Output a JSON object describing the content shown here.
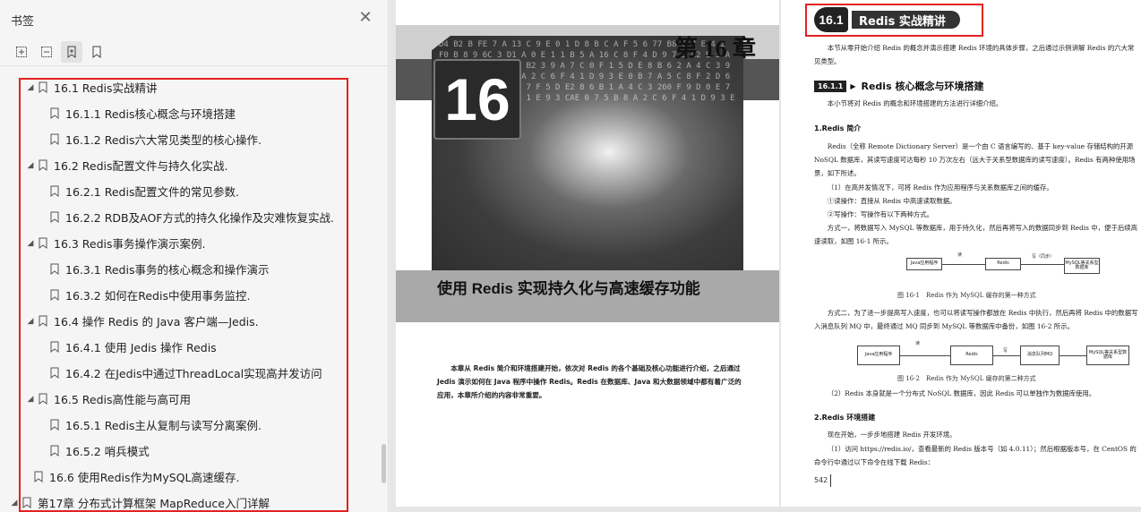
{
  "sidebar": {
    "title": "书签",
    "close_glyph": "✕",
    "tree": [
      {
        "level": "lv0",
        "expand": "◢",
        "label": "16.1 Redis实战精讲"
      },
      {
        "level": "lv1",
        "expand": "",
        "label": "16.1.1 Redis核心概念与环境搭建"
      },
      {
        "level": "lv1",
        "expand": "",
        "label": "16.1.2 Redis六大常见类型的核心操作."
      },
      {
        "level": "lv0",
        "expand": "◢",
        "label": "16.2 Redis配置文件与持久化实战."
      },
      {
        "level": "lv1",
        "expand": "",
        "label": "16.2.1 Redis配置文件的常见参数."
      },
      {
        "level": "lv1",
        "expand": "",
        "label": "16.2.2 RDB及AOF方式的持久化操作及灾难恢复实战."
      },
      {
        "level": "lv0",
        "expand": "◢",
        "label": "16.3 Redis事务操作演示案例."
      },
      {
        "level": "lv1",
        "expand": "",
        "label": "16.3.1 Redis事务的核心概念和操作演示"
      },
      {
        "level": "lv1",
        "expand": "",
        "label": "16.3.2 如何在Redis中使用事务监控."
      },
      {
        "level": "lv0",
        "expand": "◢",
        "label": "16.4 操作 Redis 的 Java 客户端—Jedis."
      },
      {
        "level": "lv1",
        "expand": "",
        "label": "16.4.1 使用 Jedis 操作 Redis"
      },
      {
        "level": "lv1",
        "expand": "",
        "label": "16.4.2 在Jedis中通过ThreadLocal实现高并发访问"
      },
      {
        "level": "lv0",
        "expand": "◢",
        "label": "16.5 Redis高性能与高可用"
      },
      {
        "level": "lv1",
        "expand": "",
        "label": "16.5.1 Redis主从复制与读写分离案例."
      },
      {
        "level": "lv1",
        "expand": "",
        "label": "16.5.2 哨兵模式"
      },
      {
        "level": "lv0-noexp",
        "expand": "",
        "label": "16.6 使用Redis作为MySQL高速缓存."
      },
      {
        "level": "lv-top",
        "expand": "◢",
        "label": "第17章 分布式计算框架 MapReduce入门详解"
      }
    ]
  },
  "left_page": {
    "chapter_label": "第 16 章",
    "chapter_number": "16",
    "chapter_title": "使用 Redis 实现持久化与高速缓存功能",
    "intro": "本章从 Redis 简介和环境搭建开始，依次对 Redis 的各个基础及核心功能进行介绍，之后通过 Jedis 演示如何在 Java 程序中操作 Redis。Redis 在数据库、Java 和大数据领域中都有着广泛的应用，本章所介绍的内容非常重要。",
    "art_chars": "D4 B2 B FE 7 A 13 C 9 E 0 1 D 8 B C A F 5 6 77 B8 C 7 E 4 2 F0 B 8 9 6C 3 D1 A 0 E 1 1 B 5 A 16 C 8 F 4 D 9 7 3 E2 B 5 A 0 C 1 F 6 8 D 4 E B2 3 9 A 7 C 0 F 1 5 D E 8 B 6 2 A 4 C 3 9 F D1 0 7 E 5 B 8 A 2 C 6 F 4 1 D 9 3 E 0 B 7 A 5 C 8 F 2 D 6 1 E 4 3 B 9 A 0 C 7 F 5 D E2 8 6 B 1 A 4 C 3 260 F 9 D 0 E 7 5 B 8 A 2 C 6 D 4 1 E 9 3 CAE 0 7 5 B 8 A 2 C 6 F 4 1 D 9 3 E 0 B 7 A"
  },
  "right_page": {
    "section_number": "16.1",
    "section_title": "Redis 实战精讲",
    "intro": "本节从零开始介绍 Redis 的概念并演示搭建 Redis 环境的具体步骤，之后通过示例讲解 Redis 的六大常见类型。",
    "subsection_number": "16.1.1",
    "subsection_title": "Redis 核心概念与环境搭建",
    "sub_intro": "本小节将对 Redis 的概念和环境搭建的方法进行详细介绍。",
    "h_redis_intro": "1.Redis 简介",
    "p_redis_intro": "Redis（全称 Remote Dictionary Server）是一个由 C 语言编写的、基于 key-value 存储结构的开源 NoSQL 数据库，其读写速度可达每秒 10 万次左右（远大于关系型数据库的读写速度）。Redis 有两种使用场景，如下所述。",
    "p_scene1": "（1）在高并发情况下，可将 Redis 作为应用程序与关系数据库之间的缓存。",
    "p_read": "①读操作：直接从 Redis 中高速读取数据。",
    "p_write": "②写操作：写操作有以下两种方式。",
    "p_way1": "方式一，将数据写入 MySQL 等数据库，用于持久化，然后再将写入的数据同步到 Redis 中，便于后续高速读取，如图 16-1 所示。",
    "fig1_caption": "图 16-1　Redis 作为 MySQL 缓存的第一种方式",
    "fig1": {
      "app": "Java应用程序",
      "redis": "Redis",
      "db": "MySQL等关系型数据库",
      "read": "读",
      "write": "写（同步）"
    },
    "p_way2": "方式二，为了进一步提高写入速度，也可以将读写操作都放在 Redis 中执行，然后再将 Redis 中的数据写入消息队列 MQ 中，最终通过 MQ 同步到 MySQL 等数据库中备份，如图 16-2 所示。",
    "fig2_caption": "图 16-2　Redis 作为 MySQL 缓存的第二种方式",
    "fig2": {
      "app": "Java应用程序",
      "redis": "Redis",
      "mq": "消息队列MQ",
      "db": "MySQL等关系型数据库",
      "read": "读",
      "write": "写"
    },
    "p_scene2": "（2）Redis 本身就是一个分布式 NoSQL 数据库，因此 Redis 可以单独作为数据库使用。",
    "h_env": "2.Redis 环境搭建",
    "p_env1": "现在开始，一步步地搭建 Redis 开发环境。",
    "p_env2": "（1）访问 https://redis.io/，查看最新的 Redis 版本号（如 4.0.11）；然后根据版本号，在 CentOS 的命令行中通过以下命令在线下载 Redis：",
    "page_number": "542"
  }
}
